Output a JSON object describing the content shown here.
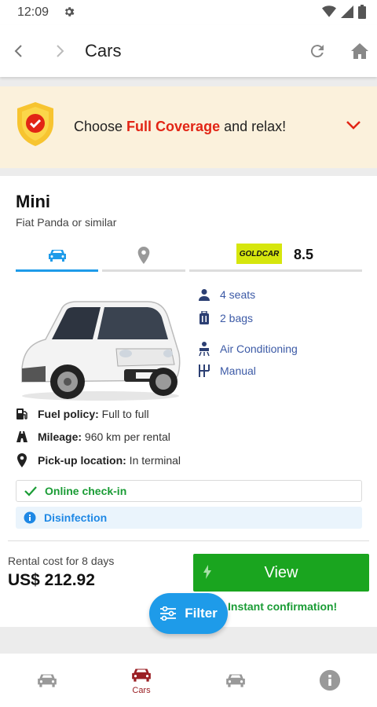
{
  "status_bar": {
    "time": "12:09"
  },
  "app_bar": {
    "title": "Cars"
  },
  "banner": {
    "prefix": "Choose ",
    "highlight": "Full Coverage",
    "suffix": " and relax!",
    "highlight_color": "#e22515"
  },
  "car": {
    "class": "Mini",
    "model": "Fiat Panda or similar",
    "supplier_logo_text": "GOLDCAR",
    "rating": "8.5",
    "features": [
      "4 seats",
      "2 bags",
      "Air Conditioning",
      "Manual"
    ],
    "specs": [
      {
        "label": "Fuel policy:",
        "value": " Full to full"
      },
      {
        "label": "Mileage:",
        "value": " 960 km per rental"
      },
      {
        "label": "Pick-up location:",
        "value": " In terminal"
      }
    ],
    "badges": {
      "checkin": "Online check-in",
      "disinfection": "Disinfection"
    },
    "rental_label": "Rental cost for 8 days",
    "price": "US$ 212.92",
    "view_label": "View",
    "instant": "Instant confirmation!"
  },
  "fab": {
    "label": "Filter"
  },
  "bottom_nav": {
    "active_label": "Cars"
  },
  "colors": {
    "accent_blue": "#1e9be9",
    "green": "#1aa51f",
    "nav_active": "#9a1f24",
    "banner_bg": "#fbf1dc"
  }
}
